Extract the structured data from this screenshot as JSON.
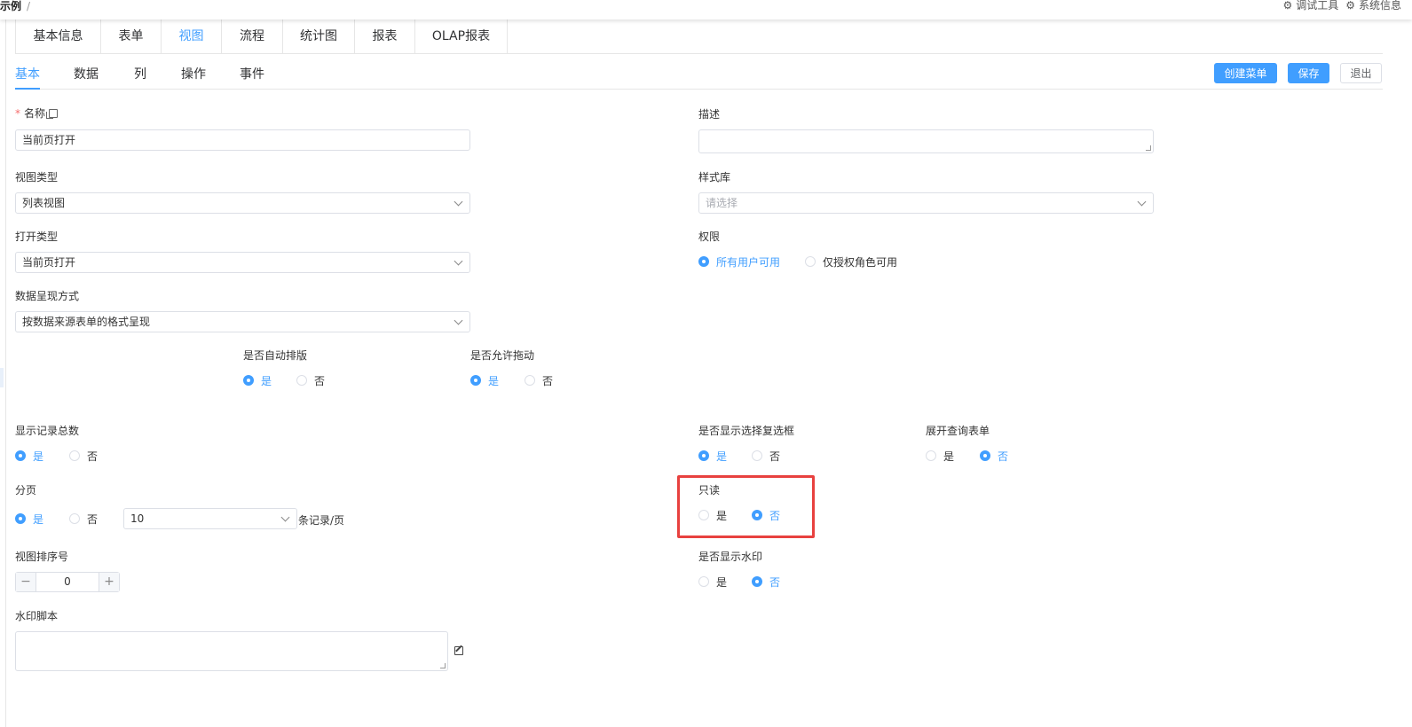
{
  "breadcrumb": {
    "current": "示例",
    "separator": "/"
  },
  "header_right": {
    "debug_tool": "调试工具",
    "system_info": "系统信息"
  },
  "main_tabs": [
    "基本信息",
    "表单",
    "视图",
    "流程",
    "统计图",
    "报表",
    "OLAP报表"
  ],
  "main_tabs_active": "视图",
  "sub_tabs": [
    "基本",
    "数据",
    "列",
    "操作",
    "事件"
  ],
  "sub_tabs_active": "基本",
  "buttons": {
    "create_menu": "创建菜单",
    "save": "保存",
    "exit": "退出"
  },
  "form": {
    "name": {
      "label": "名称",
      "value": "当前页打开"
    },
    "description": {
      "label": "描述",
      "value": ""
    },
    "view_type": {
      "label": "视图类型",
      "value": "列表视图"
    },
    "style_lib": {
      "label": "样式库",
      "placeholder": "请选择"
    },
    "open_type": {
      "label": "打开类型",
      "value": "当前页打开"
    },
    "permission": {
      "label": "权限",
      "options": [
        "所有用户可用",
        "仅授权角色可用"
      ],
      "selected": "所有用户可用"
    },
    "data_display": {
      "label": "数据呈现方式",
      "value": "按数据来源表单的格式呈现"
    },
    "auto_layout": {
      "label": "是否自动排版",
      "options": [
        "是",
        "否"
      ],
      "selected": "是"
    },
    "allow_drag": {
      "label": "是否允许拖动",
      "options": [
        "是",
        "否"
      ],
      "selected": "是"
    },
    "show_total": {
      "label": "显示记录总数",
      "options": [
        "是",
        "否"
      ],
      "selected": "是"
    },
    "show_checkbox": {
      "label": "是否显示选择复选框",
      "options": [
        "是",
        "否"
      ],
      "selected": "是"
    },
    "expand_query": {
      "label": "展开查询表单",
      "options": [
        "是",
        "否"
      ],
      "selected": "否"
    },
    "pagination": {
      "label": "分页",
      "options": [
        "是",
        "否"
      ],
      "selected": "是",
      "page_size": "10",
      "unit": "条记录/页"
    },
    "readonly": {
      "label": "只读",
      "options": [
        "是",
        "否"
      ],
      "selected": "否"
    },
    "sort_order": {
      "label": "视图排序号",
      "value": "0",
      "minus": "−",
      "plus": "+"
    },
    "show_watermark": {
      "label": "是否显示水印",
      "options": [
        "是",
        "否"
      ],
      "selected": "否"
    },
    "watermark_script": {
      "label": "水印脚本",
      "value": ""
    }
  }
}
